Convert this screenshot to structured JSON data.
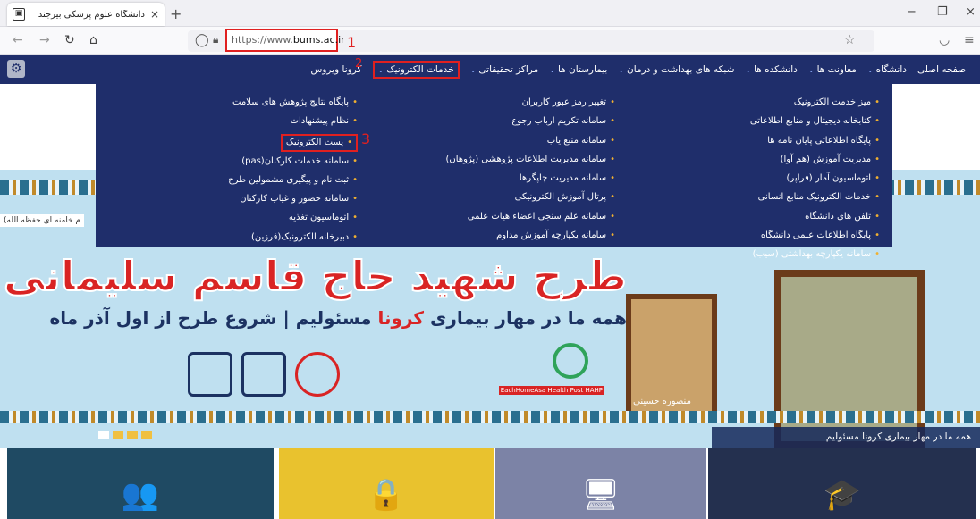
{
  "browser": {
    "tab_title": "دانشگاه علوم پزشکی بیرجند",
    "tab_close": "×",
    "new_tab": "+",
    "url_prefix": "https://www.",
    "url_domain": "bums.ac.ir",
    "window_controls": [
      "−",
      "❐",
      "×"
    ]
  },
  "annotations": {
    "label_1": "1",
    "label_2": "2",
    "label_3": "3",
    "color": "#e02020"
  },
  "site_nav": {
    "items": [
      {
        "label": "صفحه اصلی",
        "has_dropdown": false
      },
      {
        "label": "دانشگاه",
        "has_dropdown": true
      },
      {
        "label": "معاونت ها",
        "has_dropdown": true
      },
      {
        "label": "دانشکده ها",
        "has_dropdown": true
      },
      {
        "label": "شبکه های بهداشت و درمان",
        "has_dropdown": true
      },
      {
        "label": "بیمارستان ها",
        "has_dropdown": true
      },
      {
        "label": "مراکز تحقیقاتی",
        "has_dropdown": true
      },
      {
        "label": "خدمات الکترونیک",
        "has_dropdown": true,
        "active": true
      },
      {
        "label": "کرونا ویروس",
        "has_dropdown": false
      }
    ]
  },
  "dropdown": {
    "col_right": [
      "میز خدمت الکترونیک",
      "کتابخانه دیجیتال و منابع اطلاعاتی",
      "پایگاه اطلاعاتی پایان نامه ها",
      "مدیریت آموزش (هم آوا)",
      "اتوماسیون آمار (فراپر)",
      "خدمات الکترونیک منابع انسانی",
      "تلفن های دانشگاه",
      "پایگاه اطلاعات علمی دانشگاه",
      "سامانه یکپارچه بهداشتی (سیب)"
    ],
    "col_middle": [
      "تغییر رمز عبور کاربران",
      "سامانه تکریم ارباب رجوع",
      "سامانه منبع یاب",
      "سامانه مدیریت اطلاعات پژوهشی (پژوهان)",
      "سامانه مدیریت چاپگرها",
      "پرتال آموزش الکترونیکی",
      "سامانه علم سنجی اعضاء هیات علمی",
      "سامانه یکپارچه آموزش مداوم"
    ],
    "col_left": [
      "پایگاه نتایج پژوهش های سلامت",
      "نظام پیشنهادات",
      "پست الکترونیک",
      "سامانه خدمات کارکنان(pas)",
      "ثبت نام و پیگیری مشمولین طرح",
      "سامانه حضور و غیاب کارکنان",
      "اتوماسیون تغذیه",
      "دبیرخانه الکترونیک(فرزین)"
    ],
    "highlighted_index_left": 2
  },
  "hero": {
    "title": "طرح شهید حاج قاسم سلیمانی",
    "subtitle_part1": "همه ما در مهار بیماری ",
    "subtitle_red": "کرونا",
    "subtitle_part2": " مسئولیم | شروع طرح از اول آذر ماه",
    "left_label": "م خامنه ای حفظه الله)",
    "caption_person": "منصوره حسینی",
    "health_logo_text": "EachHomeAsa Health Post HAHP",
    "slide_caption": "همه ما در مهار بیماری کرونا مسئولیم",
    "slides": 4,
    "active_slide": 0
  },
  "tiles": [
    {
      "color": "#1f4a63",
      "icon": "users-icon",
      "glyph": "👥"
    },
    {
      "color": "#e9c22e",
      "icon": "user-lock-icon",
      "glyph": "🔒"
    },
    {
      "color": "#7c83a6",
      "icon": "presentation-icon",
      "glyph": "🖥"
    },
    {
      "color": "#24304f",
      "icon": "graduation-cap-icon",
      "glyph": "🎓"
    }
  ]
}
